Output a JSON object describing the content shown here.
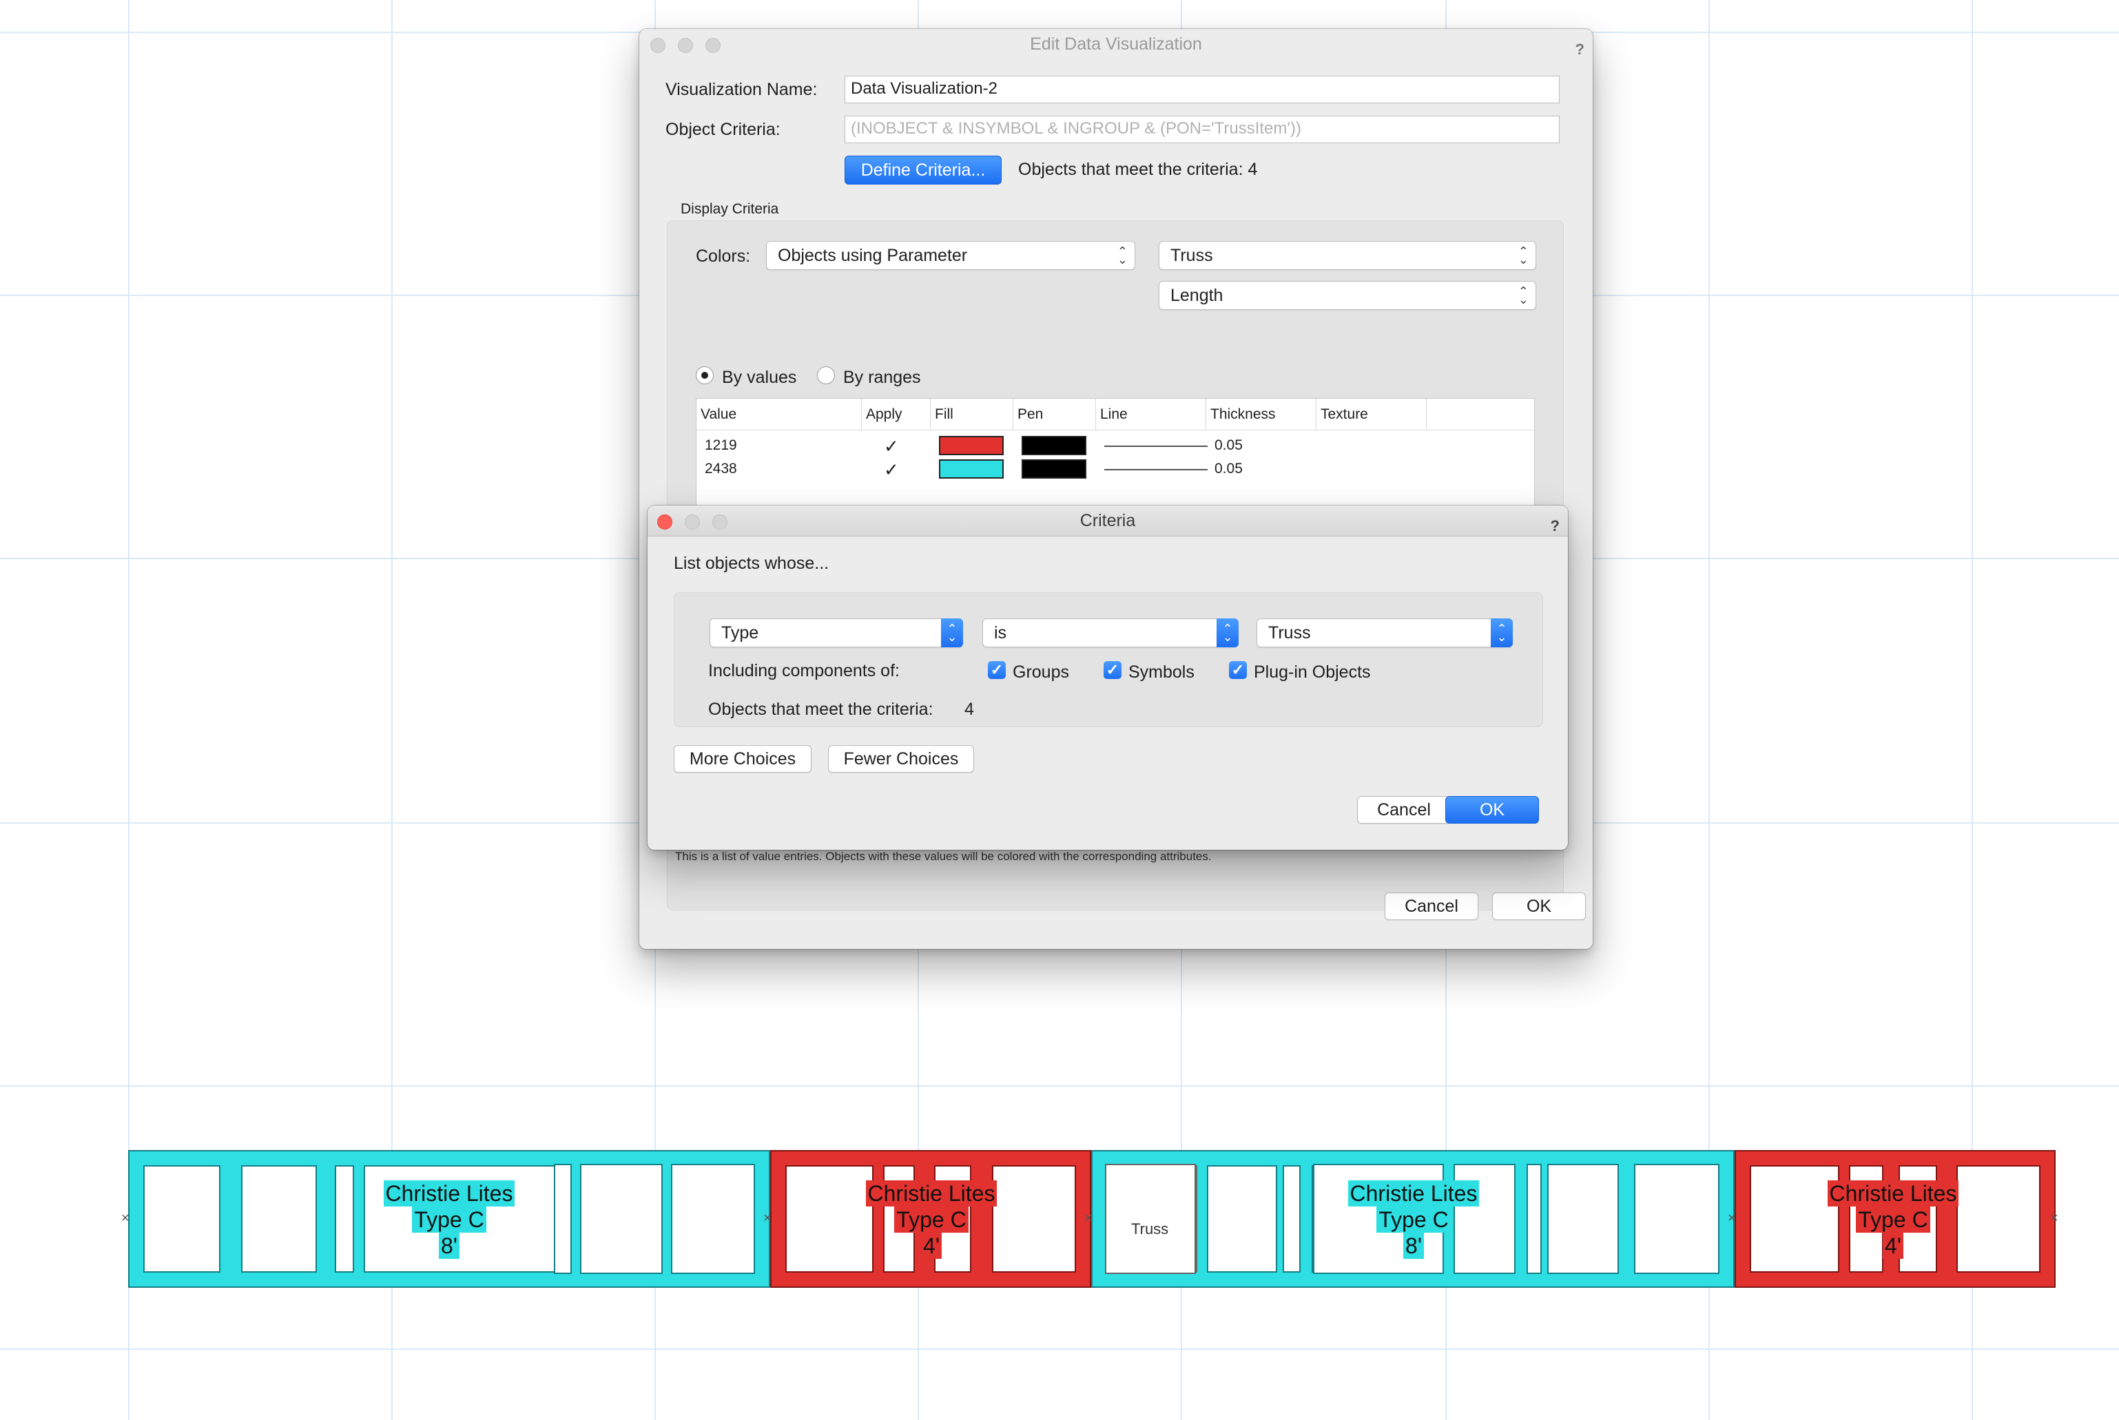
{
  "canvas": {
    "grid_color": "#dbe9f7",
    "truss_segments": [
      {
        "color": "cyan",
        "label": [
          "Christie Lites",
          "Type C",
          "8'"
        ]
      },
      {
        "color": "red",
        "label": [
          "Christie Lites",
          "Type C",
          "4'"
        ]
      },
      {
        "color": "white",
        "label_text": "Truss"
      },
      {
        "color": "cyan",
        "label": [
          "Christie Lites",
          "Type C",
          "8'"
        ]
      },
      {
        "color": "red",
        "label": [
          "Christie Lites",
          "Type C",
          "4'"
        ]
      }
    ],
    "colors": {
      "cyan": "#2ddfe2",
      "red": "#e2322f"
    }
  },
  "edit_dialog": {
    "title": "Edit Data Visualization",
    "visualization_name_label": "Visualization Name:",
    "visualization_name_value": "Data Visualization-2",
    "object_criteria_label": "Object Criteria:",
    "object_criteria_value": "(INOBJECT & INSYMBOL & INGROUP & (PON='TrussItem'))",
    "define_criteria_button": "Define Criteria...",
    "objects_meet_text": "Objects that meet the criteria: 4",
    "display_criteria_label": "Display Criteria",
    "colors_label": "Colors:",
    "colors_popup": "Objects using Parameter",
    "object_type_popup": "Truss",
    "parameter_popup": "Length",
    "by_values_label": "By values",
    "by_ranges_label": "By ranges",
    "table": {
      "headers": [
        "Value",
        "Apply",
        "Fill",
        "Pen",
        "Line",
        "Thickness",
        "Texture"
      ],
      "rows": [
        {
          "value": "1219",
          "apply": "✓",
          "fill": "#e2322f",
          "pen": "#000000",
          "thickness": "0.05"
        },
        {
          "value": "2438",
          "apply": "✓",
          "fill": "#2ddfe2",
          "pen": "#000000",
          "thickness": "0.05"
        }
      ]
    },
    "help_text": "This is a list of value entries. Objects with these values will be colored with the corresponding attributes.",
    "cancel_button": "Cancel",
    "ok_button": "OK"
  },
  "criteria_dialog": {
    "title": "Criteria",
    "list_objects_label": "List objects whose...",
    "field_popup": "Type",
    "operator_popup": "is",
    "value_popup": "Truss",
    "including_label": "Including components of:",
    "groups_label": "Groups",
    "symbols_label": "Symbols",
    "plugin_label": "Plug-in Objects",
    "meet_label": "Objects that meet the criteria:",
    "meet_count": "4",
    "more_choices": "More Choices",
    "fewer_choices": "Fewer Choices",
    "cancel_button": "Cancel",
    "ok_button": "OK"
  }
}
